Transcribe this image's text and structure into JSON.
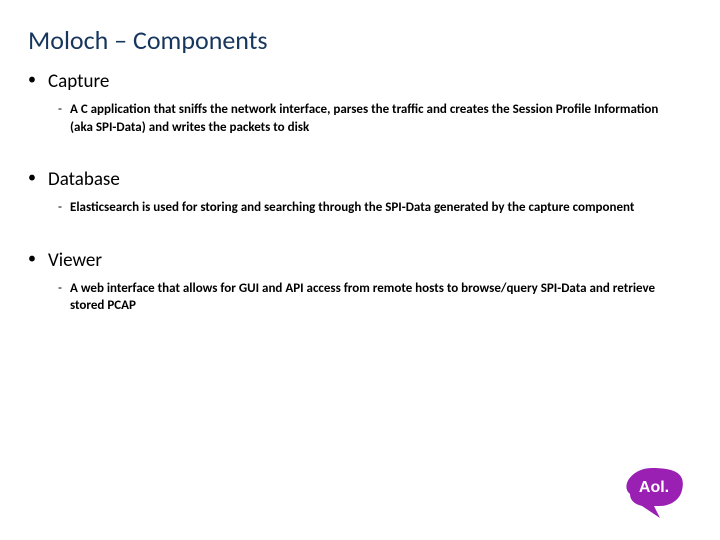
{
  "title": "Moloch – Components",
  "sections": [
    {
      "label": "Capture",
      "desc": "A C application that sniffs the network interface, parses the traffic and creates the Session Profile Information (aka SPI-Data) and writes the packets to disk"
    },
    {
      "label": "Database",
      "desc": "Elasticsearch is used for storing and searching through the SPI-Data generated by the capture component"
    },
    {
      "label": "Viewer",
      "desc": "A web interface that allows for GUI and API access from remote hosts to browse/query SPI-Data and retrieve stored PCAP"
    }
  ],
  "logo": {
    "text": "Aol.",
    "color": "#9a1fb3"
  }
}
